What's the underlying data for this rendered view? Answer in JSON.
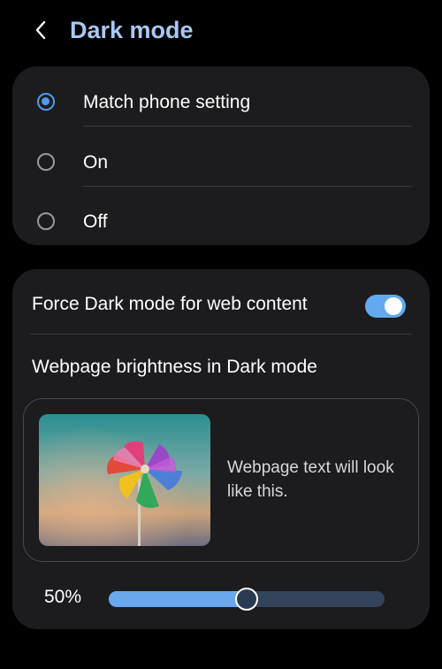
{
  "header": {
    "title": "Dark mode",
    "back_icon": "chevron-left-icon"
  },
  "dark_mode_options": {
    "selected": "Match phone setting",
    "items": [
      {
        "label": "Match phone setting",
        "checked": true
      },
      {
        "label": "On",
        "checked": false
      },
      {
        "label": "Off",
        "checked": false
      }
    ]
  },
  "web_content": {
    "force_label": "Force Dark mode for web content",
    "force_enabled": true,
    "brightness_label": "Webpage brightness in Dark mode",
    "preview_text": "Webpage text will look like this.",
    "brightness_value_label": "50%",
    "brightness_fraction": 0.5
  },
  "colors": {
    "accent": "#4c9bf0",
    "toggle_on": "#64a8ef",
    "slider_fill": "#6aa8ec",
    "card_bg": "#1c1c1e"
  }
}
